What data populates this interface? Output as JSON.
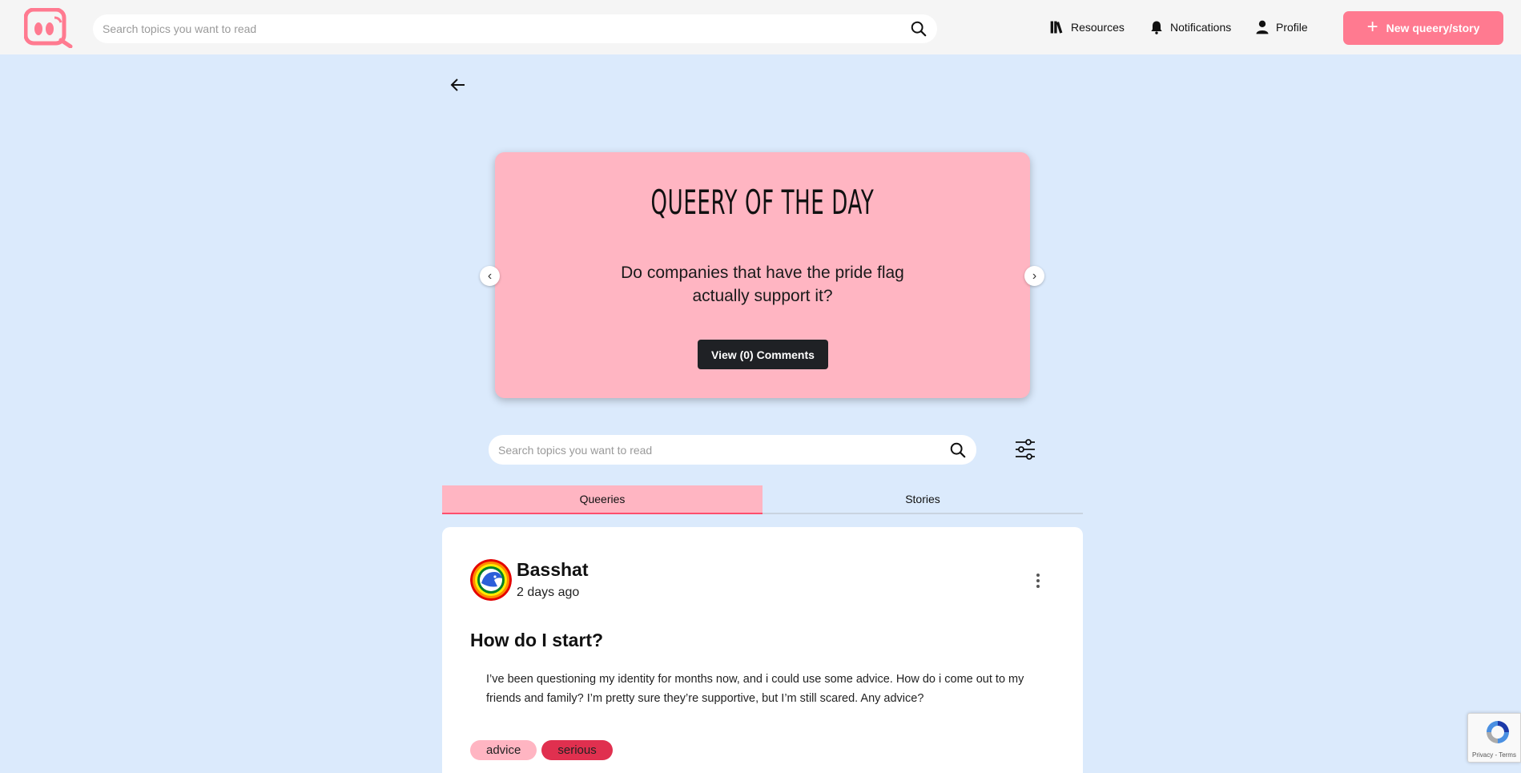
{
  "header": {
    "search_placeholder": "Search topics you want to read",
    "nav": {
      "resources": "Resources",
      "notifications": "Notifications",
      "profile": "Profile"
    },
    "new_button_label": "New queery/story",
    "new_button_icon": "plus-icon"
  },
  "qotd": {
    "title": "QUEERY OF THE DAY",
    "question": "Do companies that have the pride flag actually support it?",
    "comments_button": "View (0) Comments",
    "prev_glyph": "‹",
    "next_glyph": "›"
  },
  "feed": {
    "search_placeholder": "Search topics you want to read",
    "tabs": [
      "Queeries",
      "Stories"
    ],
    "active_tab": "Queeries"
  },
  "post": {
    "author": "Basshat",
    "time": "2 days ago",
    "title": "How do I start?",
    "body": "I’ve been questioning my identity for months now, and i could use some advice. How do i come out to my friends and family? I’m pretty sure they’re supportive, but I’m still scared. Any advice?",
    "tags": [
      "advice",
      "serious"
    ]
  },
  "recaptcha": {
    "text": "Privacy - Terms"
  },
  "colors": {
    "page_bg": "#dbeafc",
    "accent_pink": "#ff7a90",
    "card_pink": "#ffb5c2",
    "tag_red": "#e0304f",
    "dark_button": "#1f2125"
  }
}
